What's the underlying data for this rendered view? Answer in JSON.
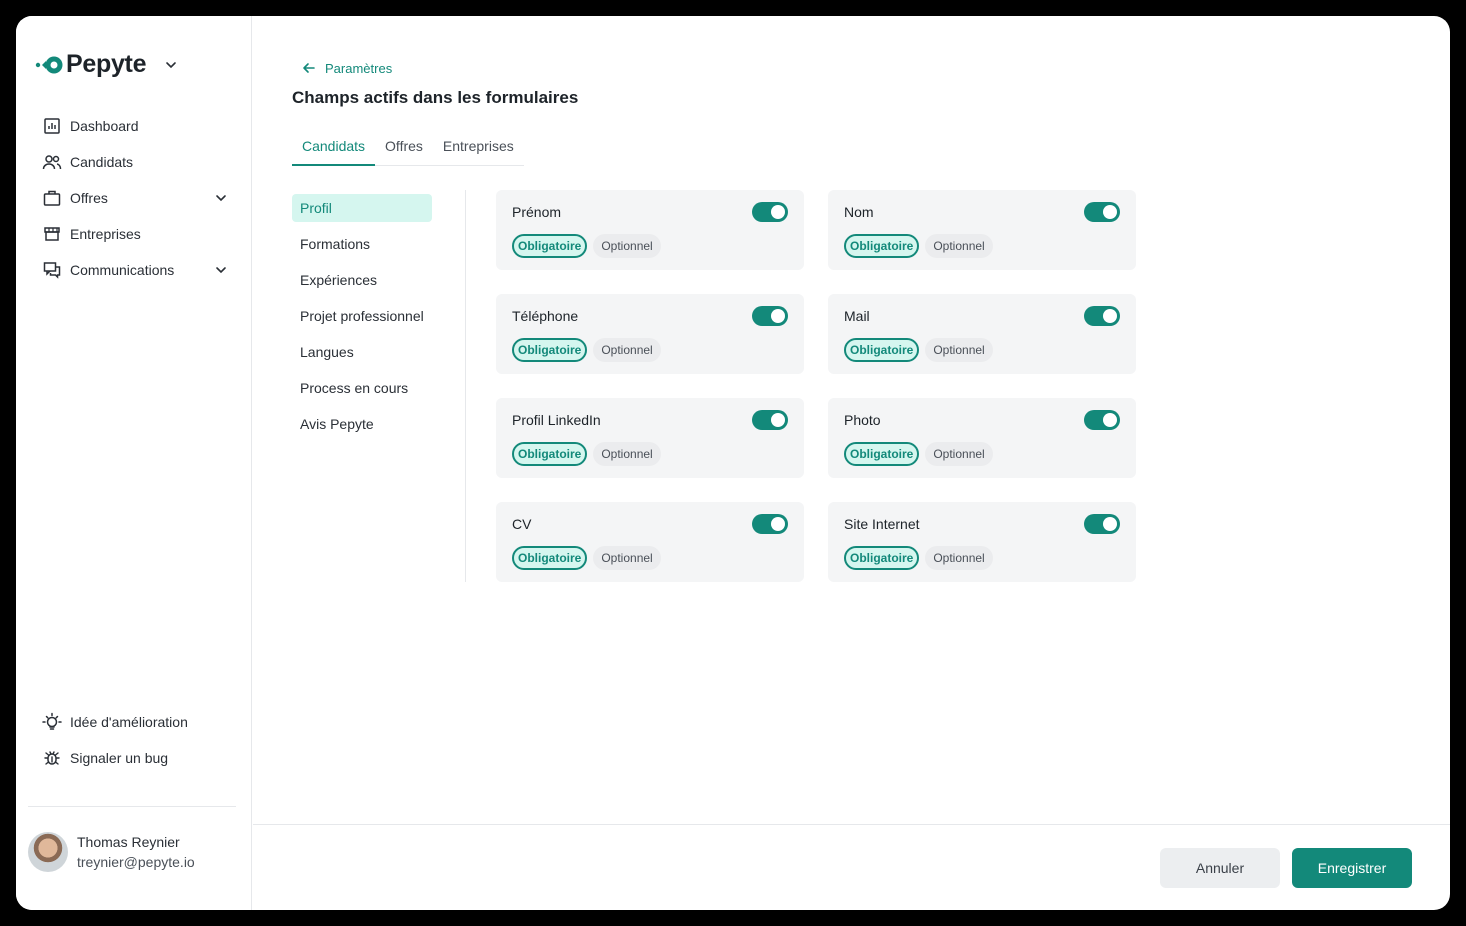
{
  "brand": {
    "name": "Pepyte",
    "accent": "#13897a",
    "accent_light": "#d5f6ef"
  },
  "sidebar": {
    "items": [
      {
        "label": "Dashboard",
        "icon": "chart-icon",
        "expandable": false
      },
      {
        "label": "Candidats",
        "icon": "users-icon",
        "expandable": false
      },
      {
        "label": "Offres",
        "icon": "briefcase-icon",
        "expandable": true
      },
      {
        "label": "Entreprises",
        "icon": "store-icon",
        "expandable": false
      },
      {
        "label": "Communications",
        "icon": "chat-icon",
        "expandable": true
      }
    ],
    "bottom_items": [
      {
        "label": "Idée d'amélioration",
        "icon": "lightbulb-icon"
      },
      {
        "label": "Signaler un bug",
        "icon": "bug-icon"
      }
    ],
    "user": {
      "name": "Thomas Reynier",
      "email": "treynier@pepyte.io"
    }
  },
  "header": {
    "back_label": "Paramètres",
    "title": "Champs actifs dans les formulaires"
  },
  "tabs": [
    {
      "label": "Candidats",
      "active": true
    },
    {
      "label": "Offres",
      "active": false
    },
    {
      "label": "Entreprises",
      "active": false
    }
  ],
  "subnav": [
    {
      "label": "Profil",
      "active": true
    },
    {
      "label": "Formations",
      "active": false
    },
    {
      "label": "Expériences",
      "active": false
    },
    {
      "label": "Projet professionnel",
      "active": false
    },
    {
      "label": "Langues",
      "active": false
    },
    {
      "label": "Process en cours",
      "active": false
    },
    {
      "label": "Avis Pepyte",
      "active": false
    }
  ],
  "fields": [
    {
      "label": "Prénom",
      "enabled": true,
      "required_label": "Obligatoire",
      "optional_label": "Optionnel",
      "mode": "required"
    },
    {
      "label": "Nom",
      "enabled": true,
      "required_label": "Obligatoire",
      "optional_label": "Optionnel",
      "mode": "required"
    },
    {
      "label": "Téléphone",
      "enabled": true,
      "required_label": "Obligatoire",
      "optional_label": "Optionnel",
      "mode": "required"
    },
    {
      "label": "Mail",
      "enabled": true,
      "required_label": "Obligatoire",
      "optional_label": "Optionnel",
      "mode": "required"
    },
    {
      "label": "Profil LinkedIn",
      "enabled": true,
      "required_label": "Obligatoire",
      "optional_label": "Optionnel",
      "mode": "required"
    },
    {
      "label": "Photo",
      "enabled": true,
      "required_label": "Obligatoire",
      "optional_label": "Optionnel",
      "mode": "required"
    },
    {
      "label": "CV",
      "enabled": true,
      "required_label": "Obligatoire",
      "optional_label": "Optionnel",
      "mode": "required"
    },
    {
      "label": "Site Internet",
      "enabled": true,
      "required_label": "Obligatoire",
      "optional_label": "Optionnel",
      "mode": "required"
    }
  ],
  "footer": {
    "cancel_label": "Annuler",
    "save_label": "Enregistrer"
  }
}
